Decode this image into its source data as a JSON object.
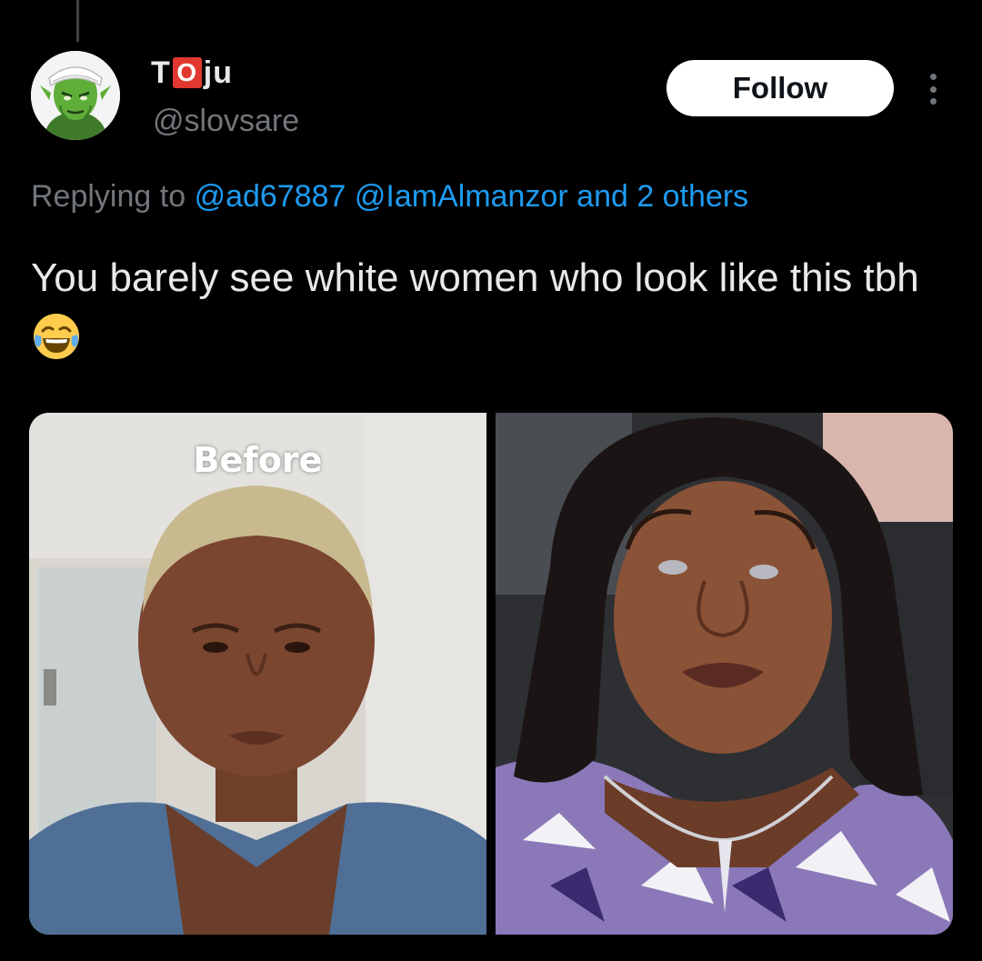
{
  "author": {
    "name_prefix": "T",
    "name_badge": "O",
    "name_suffix": "ju",
    "handle": "@slovsare",
    "avatar_icon": "green-character-avatar"
  },
  "follow_label": "Follow",
  "more_icon": "more-vertical-icon",
  "replying": {
    "prefix": "Replying to",
    "mention1": "@ad67887",
    "mention2": "@IamAlmanzor",
    "suffix": "and 2 others"
  },
  "tweet_text": "You barely see white women who look like this tbh",
  "emoji": "face-with-tears-of-joy",
  "media": {
    "left_label": "Before"
  },
  "colors": {
    "background": "#000000",
    "text": "#e7e9ea",
    "secondary": "#71767b",
    "link": "#1d9bf0",
    "button_bg": "#ffffff",
    "badge": "#e0382f"
  }
}
